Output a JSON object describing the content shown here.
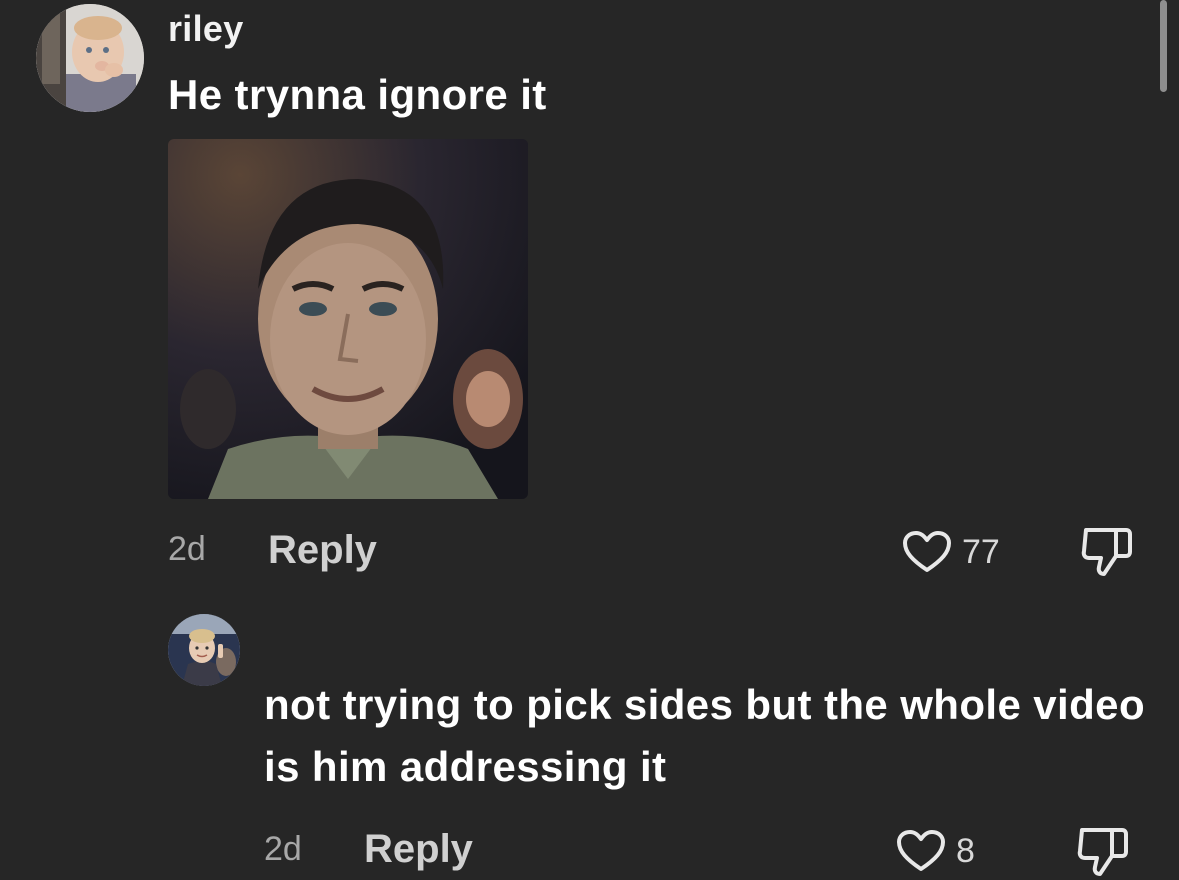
{
  "comments": [
    {
      "username": "riley",
      "text": "He trynna ignore it",
      "has_image": true,
      "time": "2d",
      "reply_label": "Reply",
      "likes": "77",
      "avatar_icon": "baby-photo-avatar",
      "image_icon": "smiling-man-photo"
    },
    {
      "username": "",
      "text": "not trying to pick sides but the whole video is him addressing it",
      "has_image": false,
      "time": "2d",
      "reply_label": "Reply",
      "likes": "8",
      "avatar_icon": "child-photo-avatar"
    }
  ],
  "icons": {
    "like": "heart-icon",
    "dislike": "thumbs-down-icon"
  },
  "colors": {
    "background": "#262626",
    "text": "#ffffff",
    "meta": "#a8a8a8"
  }
}
